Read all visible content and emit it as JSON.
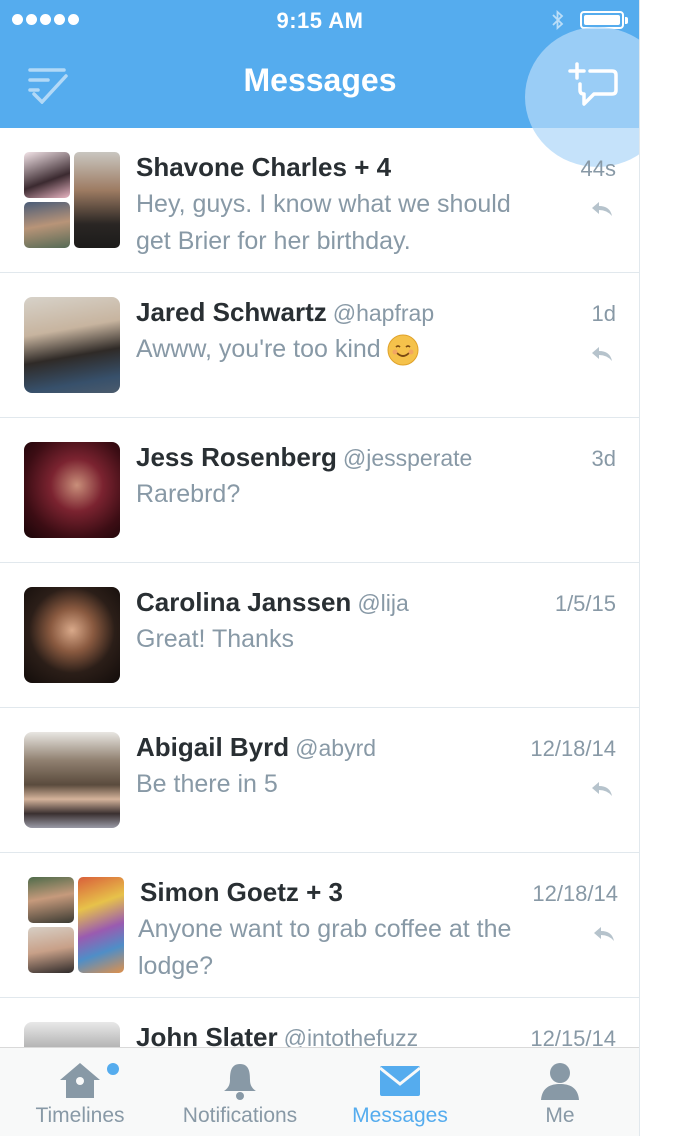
{
  "status_bar": {
    "time": "9:15 AM"
  },
  "header": {
    "title": "Messages",
    "left_icon": "edit-check-icon",
    "right_icon": "compose-message-icon"
  },
  "colors": {
    "brand": "#55acee",
    "name": "#292f33",
    "secondary": "#8899a6"
  },
  "conversations": [
    {
      "name": "Shavone Charles + 4",
      "handle": "",
      "time": "44s",
      "message": "Hey, guys. I know what we should get Brier for her birthday.",
      "replied": true
    },
    {
      "name": "Jared Schwartz",
      "handle": "@hapfrap",
      "time": "1d",
      "message": "Awww, you're too kind",
      "replied": true
    },
    {
      "name": "Jess Rosenberg",
      "handle": "@jessperate",
      "time": "3d",
      "message": "Rarebrd?",
      "replied": false
    },
    {
      "name": "Carolina Janssen",
      "handle": "@lija",
      "time": "1/5/15",
      "message": "Great! Thanks",
      "replied": false
    },
    {
      "name": "Abigail Byrd",
      "handle": "@abyrd",
      "time": "12/18/14",
      "message": "Be there in 5",
      "replied": true
    },
    {
      "name": "Simon Goetz + 3",
      "handle": "",
      "time": "12/18/14",
      "message": "Anyone want to grab coffee at the lodge?",
      "replied": true
    },
    {
      "name": "John Slater",
      "handle": "@intothefuzz",
      "time": "12/15/14",
      "message": "",
      "replied": false
    }
  ],
  "tabs": [
    {
      "label": "Timelines",
      "icon": "home-icon",
      "active": false
    },
    {
      "label": "Notifications",
      "icon": "bell-icon",
      "active": false
    },
    {
      "label": "Messages",
      "icon": "envelope-icon",
      "active": true
    },
    {
      "label": "Me",
      "icon": "person-icon",
      "active": false
    }
  ]
}
